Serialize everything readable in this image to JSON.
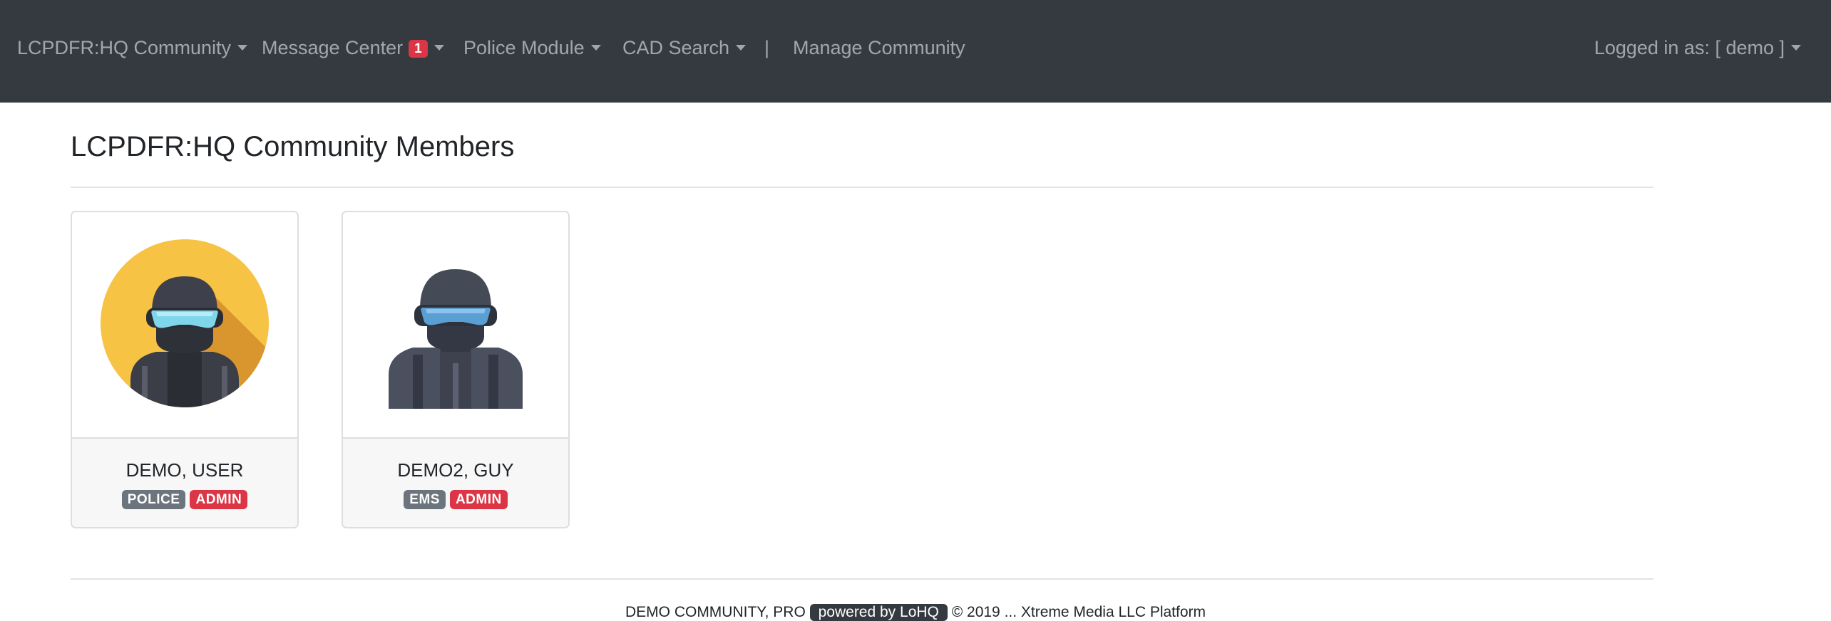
{
  "navbar": {
    "community_menu": "LCPDFR:HQ Community",
    "message_center": "Message Center",
    "message_count": "1",
    "police_module": "Police Module",
    "cad_search": "CAD Search",
    "divider": "|",
    "manage_community": "Manage Community",
    "logged_in": "Logged in as: [ demo ]"
  },
  "page": {
    "title": "LCPDFR:HQ Community Members"
  },
  "members": [
    {
      "name": "DEMO, USER",
      "badges": [
        "POLICE",
        "ADMIN"
      ],
      "avatar": "swat-officer-yellow-circle-icon"
    },
    {
      "name": "DEMO2, GUY",
      "badges": [
        "EMS",
        "ADMIN"
      ],
      "avatar": "swat-officer-icon"
    }
  ],
  "colors": {
    "navbar_bg": "#343a40",
    "badge_secondary": "#6c757d",
    "badge_danger": "#dc3545",
    "avatar_circle": "#f6c344"
  },
  "footer": {
    "left": "DEMO COMMUNITY, PRO ",
    "pill": "powered by LoHQ",
    "right": " © 2019 ... Xtreme Media LLC Platform"
  }
}
